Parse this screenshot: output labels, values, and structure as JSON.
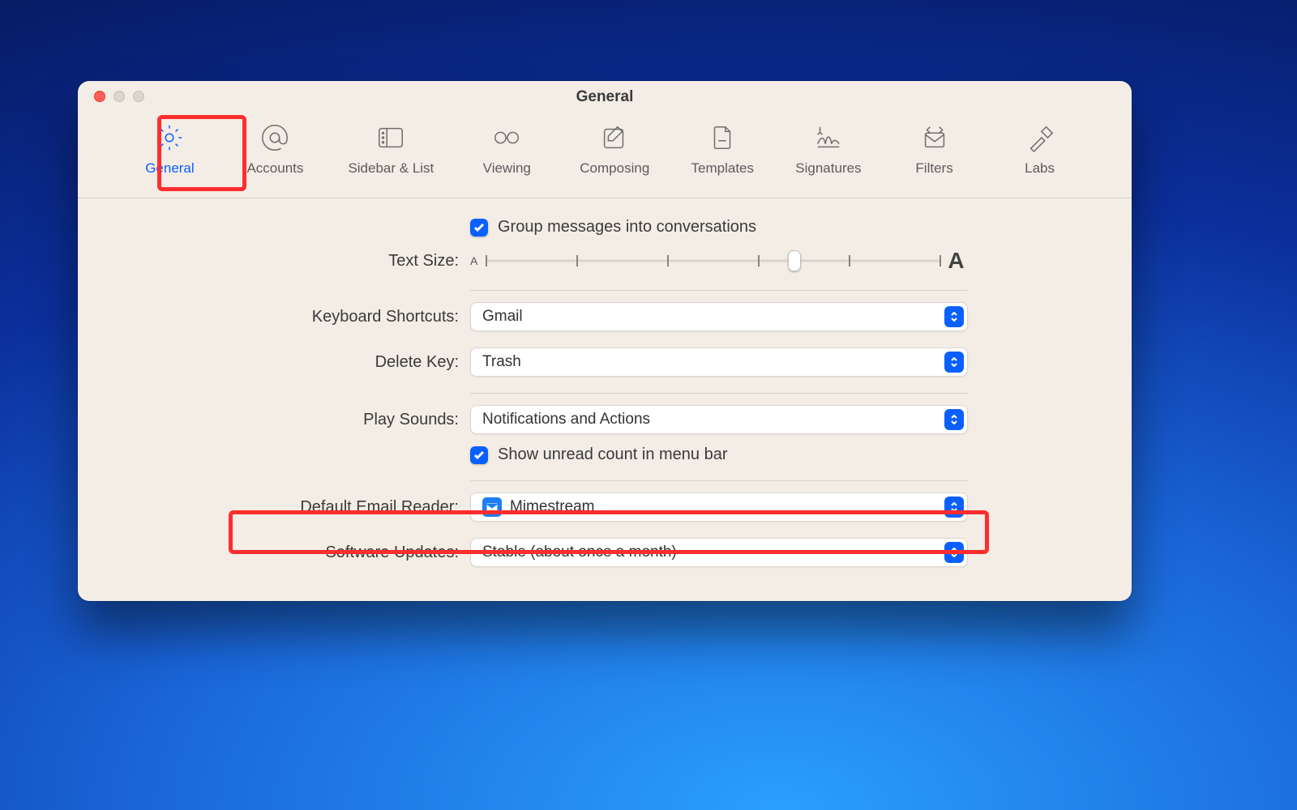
{
  "window": {
    "title": "General"
  },
  "tabs": [
    {
      "id": "general",
      "label": "General"
    },
    {
      "id": "accounts",
      "label": "Accounts"
    },
    {
      "id": "sidebar",
      "label": "Sidebar & List"
    },
    {
      "id": "viewing",
      "label": "Viewing"
    },
    {
      "id": "composing",
      "label": "Composing"
    },
    {
      "id": "templates",
      "label": "Templates"
    },
    {
      "id": "signatures",
      "label": "Signatures"
    },
    {
      "id": "filters",
      "label": "Filters"
    },
    {
      "id": "labs",
      "label": "Labs"
    }
  ],
  "settings": {
    "group_conversations": {
      "label": "Group messages into conversations",
      "checked": true
    },
    "text_size": {
      "label": "Text Size:"
    },
    "keyboard": {
      "label": "Keyboard Shortcuts:",
      "value": "Gmail"
    },
    "delete_key": {
      "label": "Delete Key:",
      "value": "Trash"
    },
    "play_sounds": {
      "label": "Play Sounds:",
      "value": "Notifications and Actions"
    },
    "unread_menu": {
      "label": "Show unread count in menu bar",
      "checked": true
    },
    "default_reader": {
      "label": "Default Email Reader:",
      "value": "Mimestream"
    },
    "updates": {
      "label": "Software Updates:",
      "value": "Stable (about once a month)"
    }
  },
  "slider_letters": {
    "small": "A",
    "large": "A"
  }
}
